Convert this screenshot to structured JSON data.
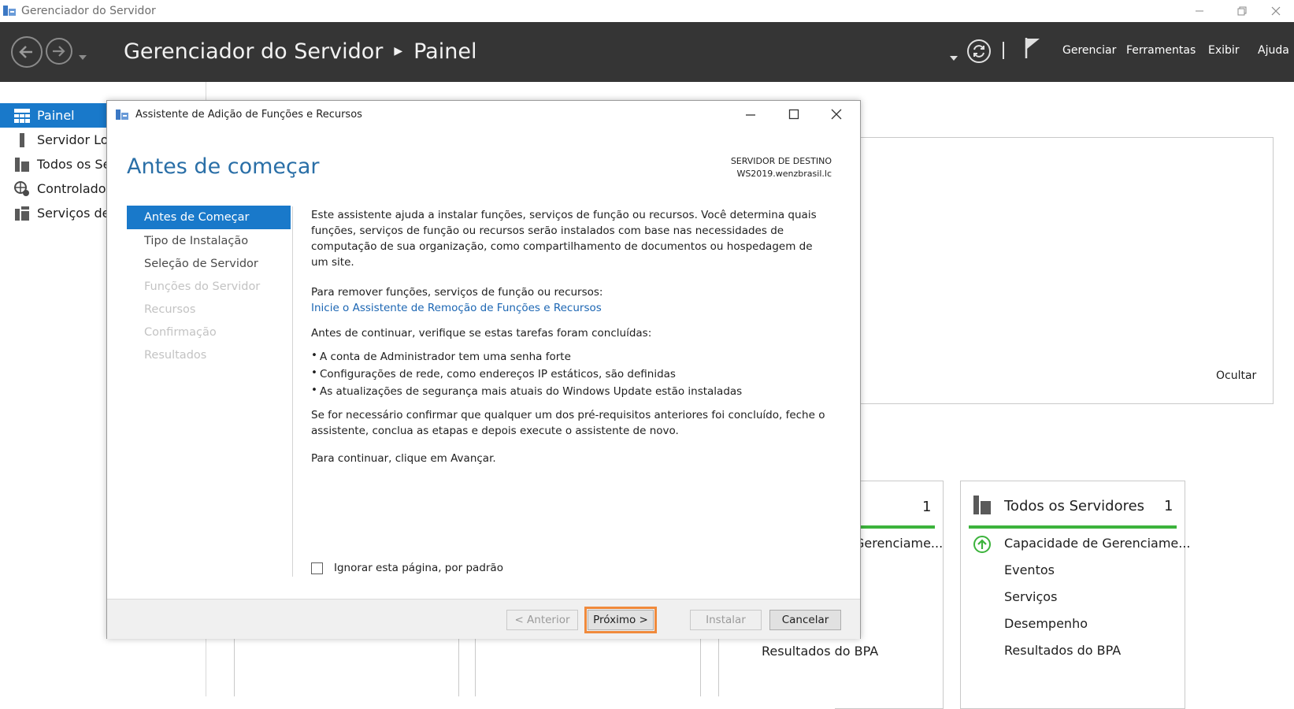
{
  "window": {
    "title": "Gerenciador do Servidor"
  },
  "header": {
    "breadcrumb_app": "Gerenciador do Servidor",
    "breadcrumb_page": "Painel",
    "menu": [
      "Gerenciar",
      "Ferramentas",
      "Exibir",
      "Ajuda"
    ]
  },
  "sidebar": {
    "items": [
      {
        "label": "Painel",
        "active": true,
        "icon": "dashboard-icon"
      },
      {
        "label": "Servidor Lo",
        "active": false,
        "icon": "server-icon"
      },
      {
        "label": "Todos os Se",
        "active": false,
        "icon": "servers-icon"
      },
      {
        "label": "Controlador",
        "active": false,
        "icon": "domain-controller-icon"
      },
      {
        "label": "Serviços de",
        "active": false,
        "icon": "services-icon"
      }
    ]
  },
  "background": {
    "hide_label": "Ocultar",
    "tile_partial": {
      "count": "1",
      "line1": "Gerenciame...",
      "bpa": "Resultados do BPA"
    },
    "tile_all_servers": {
      "title": "Todos os Servidores",
      "count": "1",
      "lines": [
        "Capacidade de Gerenciame...",
        "Eventos",
        "Serviços",
        "Desempenho",
        "Resultados do BPA"
      ]
    }
  },
  "dialog": {
    "title": "Assistente de Adição de Funções e Recursos",
    "heading": "Antes de começar",
    "dest_label": "SERVIDOR DE DESTINO",
    "dest_server": "WS2019.wenzbrasil.lc",
    "steps": [
      {
        "label": "Antes de Começar",
        "state": "active"
      },
      {
        "label": "Tipo de Instalação",
        "state": "enabled"
      },
      {
        "label": "Seleção de Servidor",
        "state": "enabled"
      },
      {
        "label": "Funções do Servidor",
        "state": "disabled"
      },
      {
        "label": "Recursos",
        "state": "disabled"
      },
      {
        "label": "Confirmação",
        "state": "disabled"
      },
      {
        "label": "Resultados",
        "state": "disabled"
      }
    ],
    "intro": "Este assistente ajuda a instalar funções, serviços de função ou recursos. Você determina quais funções, serviços de função ou recursos serão instalados com base nas necessidades de computação de sua organização, como compartilhamento de documentos ou hospedagem de um site.",
    "remove_text": "Para remover funções, serviços de função ou recursos:",
    "remove_link": "Inicie o Assistente de Remoção de Funções e Recursos",
    "check_text": "Antes de continuar, verifique se estas tarefas foram concluídas:",
    "checklist": [
      "A conta de Administrador tem uma senha forte",
      "Configurações de rede, como endereços IP estáticos, são definidas",
      "As atualizações de segurança mais atuais do Windows Update estão instaladas"
    ],
    "confirm_text": "Se for necessário confirmar que qualquer um dos pré-requisitos anteriores foi concluído, feche o assistente, conclua as etapas e depois execute o assistente de novo.",
    "continue_text": "Para continuar, clique em Avançar.",
    "skip_label": "Ignorar esta página, por padrão",
    "buttons": {
      "previous": "< Anterior",
      "next": "Próximo >",
      "install": "Instalar",
      "cancel": "Cancelar"
    }
  },
  "colors": {
    "accent": "#1979ca",
    "header_bg": "#353535",
    "heading_blue": "#2a6fa7",
    "focus_orange": "#f08a3c",
    "tile_green": "#3cb33c"
  }
}
